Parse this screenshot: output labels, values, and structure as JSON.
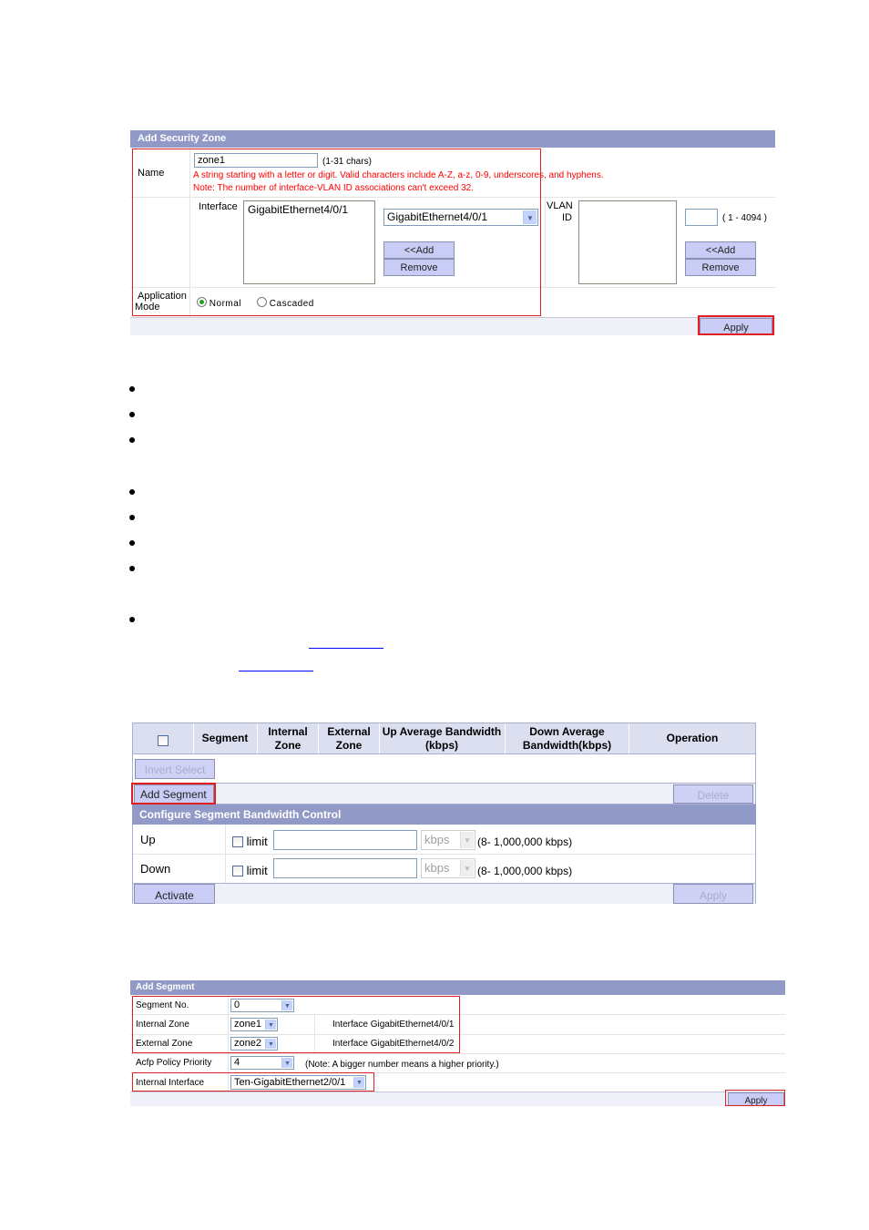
{
  "security_zone": {
    "title": "Add Security Zone",
    "name_label": "Name",
    "name_value": "zone1",
    "name_hint": "(1-31 chars)",
    "name_rule": "A string starting with a letter or digit. Valid characters include A-Z, a-z, 0-9, underscores, and hyphens.",
    "name_note": "Note: The number of interface-VLAN ID associations can't exceed  32.",
    "interface_label": "Interface",
    "interface_list": [
      "GigabitEthernet4/0/1"
    ],
    "interface_select": "GigabitEthernet4/0/1",
    "add_label": "<<Add",
    "remove_label": "Remove",
    "vlan_label_1": "VLAN",
    "vlan_label_2": "ID",
    "vlan_value": "",
    "vlan_range": "( 1 - 4094 )",
    "vlan_add_label": "<<Add",
    "vlan_remove_label": "Remove",
    "app_mode_label_1": "Application",
    "app_mode_label_2": "Mode",
    "mode_normal": "Normal",
    "mode_cascaded": "Cascaded",
    "mode_selected": "Normal",
    "apply_label": "Apply"
  },
  "bullets": {
    "group1_count": 3,
    "group2_count": 4,
    "group3_count": 1
  },
  "segment_list": {
    "headers": [
      "Segment",
      "Internal Zone",
      "External Zone",
      "Up Average Bandwidth (kbps)",
      "Down Average Bandwidth(kbps)",
      "Operation"
    ],
    "header_lines": [
      [
        "Segment"
      ],
      [
        "Internal",
        "Zone"
      ],
      [
        "External",
        "Zone"
      ],
      [
        "Up Average Bandwidth",
        "(kbps)"
      ],
      [
        "Down Average",
        "Bandwidth(kbps)"
      ],
      [
        "Operation"
      ]
    ],
    "invert_select_label": "Invert Select",
    "add_segment_label": "Add Segment",
    "delete_label": "Delete",
    "bw_title": "Configure Segment Bandwidth Control",
    "up_label": "Up",
    "down_label": "Down",
    "limit_label": "limit",
    "unit": "kbps",
    "range": "(8- 1,000,000 kbps)",
    "up_value": "",
    "down_value": "",
    "activate_label": "Activate",
    "apply_label": "Apply"
  },
  "add_segment": {
    "title": "Add Segment",
    "segment_no_label": "Segment No.",
    "segment_no_value": "0",
    "internal_zone_label": "Internal Zone",
    "internal_zone_value": "zone1",
    "internal_zone_info": "Interface GigabitEthernet4/0/1",
    "external_zone_label": "External Zone",
    "external_zone_value": "zone2",
    "external_zone_info": "Interface GigabitEthernet4/0/2",
    "priority_label": "Acfp Policy Priority",
    "priority_value": "4",
    "priority_note": "(Note: A bigger number means a higher priority.)",
    "internal_interface_label": "Internal Interface",
    "internal_interface_value": "Ten-GigabitEthernet2/0/1",
    "apply_label": "Apply"
  }
}
